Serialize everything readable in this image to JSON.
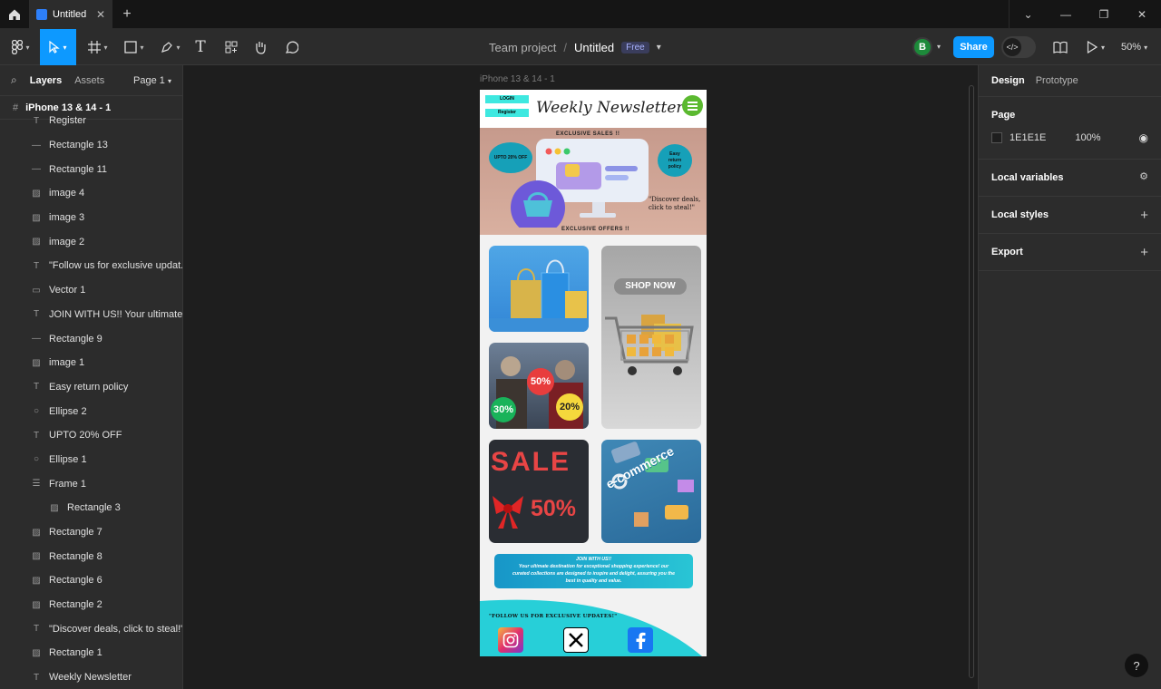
{
  "titlebar": {
    "tab_title": "Untitled"
  },
  "toolbar": {
    "team": "Team project",
    "slash": "/",
    "file": "Untitled",
    "plan_badge": "Free",
    "avatar_initial": "B",
    "share_label": "Share",
    "zoom": "50%"
  },
  "left_panel": {
    "tab_layers": "Layers",
    "tab_assets": "Assets",
    "page_select": "Page 1",
    "frame_name": "iPhone 13 & 14 - 1",
    "layers": [
      {
        "icon": "text-icon",
        "label": "Register"
      },
      {
        "icon": "line-icon",
        "label": "Rectangle 13"
      },
      {
        "icon": "line-icon",
        "label": "Rectangle 11"
      },
      {
        "icon": "image-icon",
        "label": "image 4"
      },
      {
        "icon": "image-icon",
        "label": "image 3"
      },
      {
        "icon": "image-icon",
        "label": "image 2"
      },
      {
        "icon": "text-icon",
        "label": "\"Follow us for exclusive updat..."
      },
      {
        "icon": "vector-icon",
        "label": "Vector 1"
      },
      {
        "icon": "text-icon",
        "label": "JOIN WITH US!! Your ultimate..."
      },
      {
        "icon": "line-icon",
        "label": "Rectangle 9"
      },
      {
        "icon": "image-icon",
        "label": "image 1"
      },
      {
        "icon": "text-icon",
        "label": "Easy return policy"
      },
      {
        "icon": "ellipse-icon",
        "label": "Ellipse 2"
      },
      {
        "icon": "text-icon",
        "label": "UPTO 20% OFF"
      },
      {
        "icon": "ellipse-icon",
        "label": "Ellipse 1"
      },
      {
        "icon": "frame-icon",
        "label": "Frame 1"
      },
      {
        "icon": "image-icon",
        "label": "Rectangle 3",
        "indent": true
      },
      {
        "icon": "image-icon",
        "label": "Rectangle 7"
      },
      {
        "icon": "image-icon",
        "label": "Rectangle 8"
      },
      {
        "icon": "image-icon",
        "label": "Rectangle 6"
      },
      {
        "icon": "image-icon",
        "label": "Rectangle 2"
      },
      {
        "icon": "text-icon",
        "label": "\"Discover deals, click to steal!\""
      },
      {
        "icon": "image-icon",
        "label": "Rectangle 1"
      },
      {
        "icon": "text-icon",
        "label": "Weekly Newsletter"
      }
    ]
  },
  "canvas": {
    "frame_label": "iPhone 13 & 14 - 1"
  },
  "design": {
    "login": "LOGIN",
    "register": "Register",
    "title": "Weekly Newsletter",
    "exclusive_sales": "EXCLUSIVE SALES !!",
    "upto": "UPTO 20% OFF",
    "easy_return": "Easy return policy",
    "discover": "\"Discover deals, click to steal!\"",
    "exclusive_offers": "EXCLUSIVE OFFERS !!",
    "shop_now": "SHOP NOW",
    "badge_50": "50%",
    "badge_30": "30%",
    "badge_20": "20%",
    "sale": "SALE",
    "sale_pct": "50%",
    "ecommerce": "e-commerce",
    "join_title": "JOIN WITH US!!",
    "join_body": "Your ultimate destination for exceptional shopping experience! our curated collections are designed to inspire and delight, assuring you the best in quality and value.",
    "follow": "\"FOLLOW US FOR EXCLUSIVE UPDATES!\""
  },
  "right_panel": {
    "tab_design": "Design",
    "tab_prototype": "Prototype",
    "page_heading": "Page",
    "page_color": "1E1E1E",
    "page_opacity": "100%",
    "local_variables": "Local variables",
    "local_styles": "Local styles",
    "export": "Export",
    "help": "?"
  },
  "colors": {
    "accent": "#0d99ff",
    "canvas": "#1e1e1e",
    "panel": "#2c2c2c"
  }
}
